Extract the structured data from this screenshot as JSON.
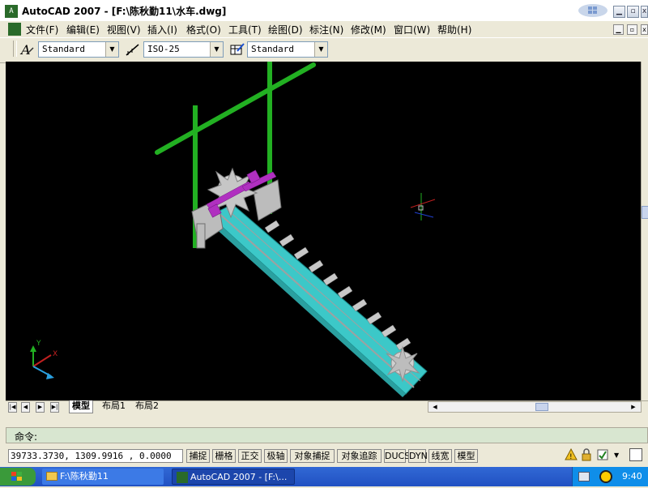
{
  "window": {
    "title": "AutoCAD 2007 - [F:\\陈秋勤11\\水车.dwg]",
    "app_icon_text": "A"
  },
  "menu": [
    "文件(F)",
    "编辑(E)",
    "视图(V)",
    "插入(I)",
    "格式(O)",
    "工具(T)",
    "绘图(D)",
    "标注(N)",
    "修改(M)",
    "窗口(W)",
    "帮助(H)"
  ],
  "toolbar": {
    "text_style": "Standard",
    "dim_style": "ISO-25",
    "table_style": "Standard"
  },
  "layout_tabs": [
    "模型",
    "布局1",
    "布局2"
  ],
  "active_tab": "模型",
  "command": {
    "prompt": "命令:"
  },
  "status": {
    "coords": "39733.3730,  1309.9916 ,  0.0000",
    "buttons": [
      "捕捉",
      "栅格",
      "正交",
      "极轴",
      "对象捕捉",
      "对象追踪",
      "DUCS",
      "DYN",
      "线宽",
      "模型"
    ]
  },
  "ucs": {
    "y": "Y",
    "x": "X"
  },
  "taskbar": {
    "folder_task": "F:\\陈秋勤11",
    "app_task": "AutoCAD 2007 - [F:\\...",
    "clock": "9:40"
  },
  "colors": {
    "canvas": "#000000",
    "frame": "#22b022",
    "trough": "#3cc8c8",
    "wheel": "#c0c0c0",
    "connector": "#b030c0",
    "taskbar": "#2a5fd0"
  }
}
